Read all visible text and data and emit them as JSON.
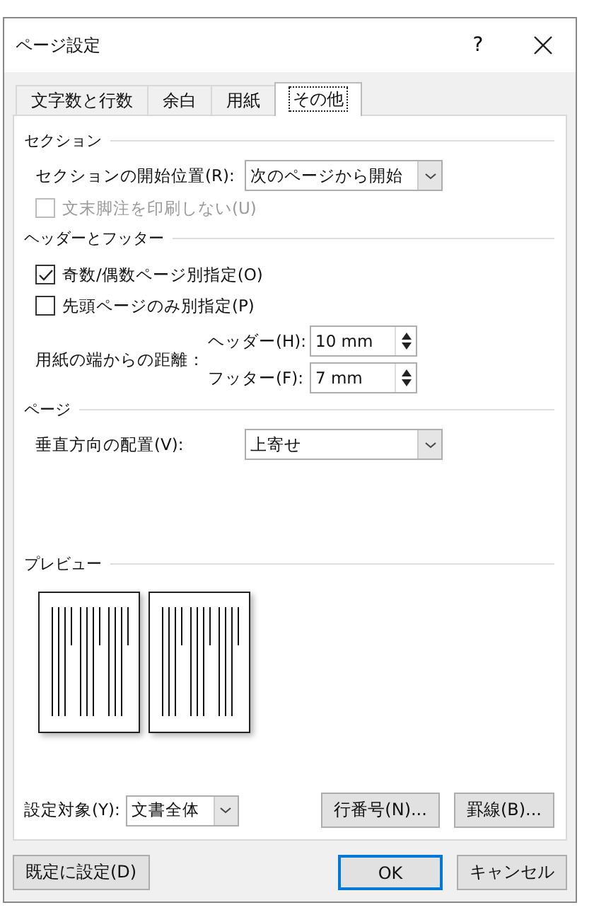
{
  "window": {
    "title": "ページ設定",
    "help": "?"
  },
  "tabs": [
    {
      "label": "文字数と行数",
      "selected": false
    },
    {
      "label": "余白",
      "selected": false
    },
    {
      "label": "用紙",
      "selected": false
    },
    {
      "label": "その他",
      "selected": true
    }
  ],
  "section": {
    "heading": "セクション",
    "start_label": "セクションの開始位置(R):",
    "start_value": "次のページから開始",
    "checkbox": {
      "label": "文末脚注を印刷しない(U)",
      "checked": false,
      "disabled": true
    }
  },
  "header_footer": {
    "heading": "ヘッダーとフッター",
    "checkboxes": [
      {
        "label": "奇数/偶数ページ別指定(O)",
        "checked": true,
        "disabled": false
      },
      {
        "label": "先頭ページのみ別指定(P)",
        "checked": false,
        "disabled": false
      }
    ],
    "distance_label": "用紙の端からの距離：",
    "spins": [
      {
        "label": "ヘッダー(H):",
        "value": "10 mm"
      },
      {
        "label": "フッター(F):",
        "value": "7 mm"
      }
    ]
  },
  "page": {
    "heading": "ページ",
    "align_label": "垂直方向の配置(V):",
    "align_value": "上寄せ"
  },
  "preview": {
    "heading": "プレビュー"
  },
  "apply": {
    "label": "設定対象(Y):",
    "value": "文書全体"
  },
  "side_buttons": [
    "行番号(N)...",
    "罫線(B)..."
  ],
  "footer_buttons": [
    {
      "label": "既定に設定(D)",
      "default": false
    },
    {
      "label": "OK",
      "default": true
    },
    {
      "label": "キャンセル",
      "default": false
    }
  ]
}
